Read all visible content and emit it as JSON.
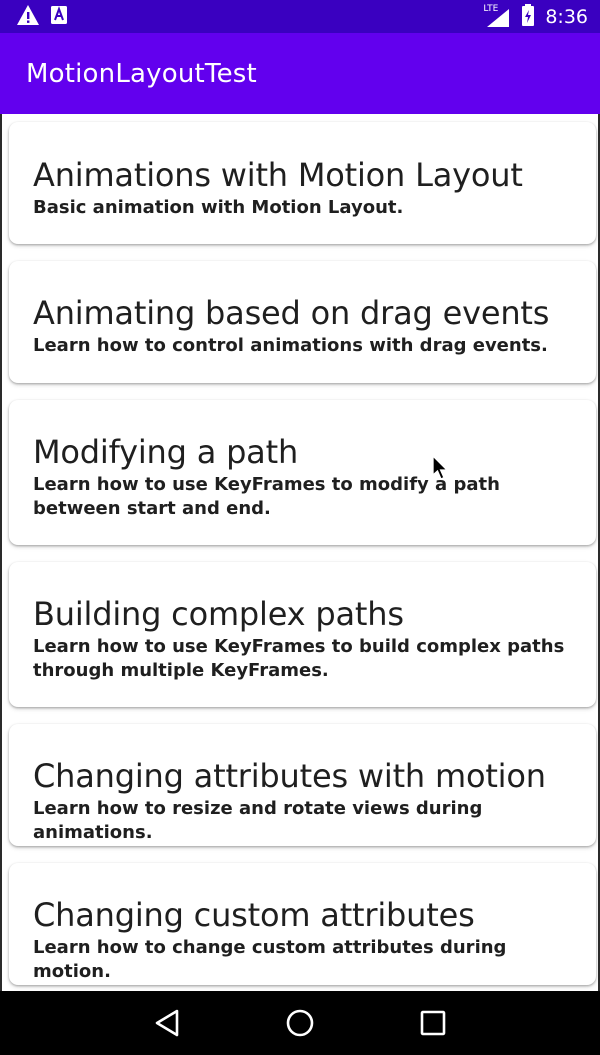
{
  "status_bar": {
    "time": "8:36",
    "network": "LTE",
    "icons": [
      "warning-icon",
      "notification-a-icon",
      "signal-icon",
      "battery-icon"
    ]
  },
  "app_bar": {
    "title": "MotionLayoutTest",
    "color": "#6200ee"
  },
  "cards": [
    {
      "title": "Animations with Motion Layout",
      "description": "Basic animation with Motion Layout."
    },
    {
      "title": "Animating based on drag events",
      "description": "Learn how to control animations with drag events."
    },
    {
      "title": "Modifying a path",
      "description": "Learn how to use KeyFrames to modify a path between start and end."
    },
    {
      "title": "Building complex paths",
      "description": "Learn how to use KeyFrames to build complex paths through multiple KeyFrames."
    },
    {
      "title": "Changing attributes with motion",
      "description": "Learn how to resize and rotate views during animations."
    },
    {
      "title": "Changing custom attributes",
      "description": "Learn how to change custom attributes during motion."
    }
  ],
  "nav_bar": {
    "icons": [
      "back-icon",
      "home-icon",
      "recents-icon"
    ]
  }
}
